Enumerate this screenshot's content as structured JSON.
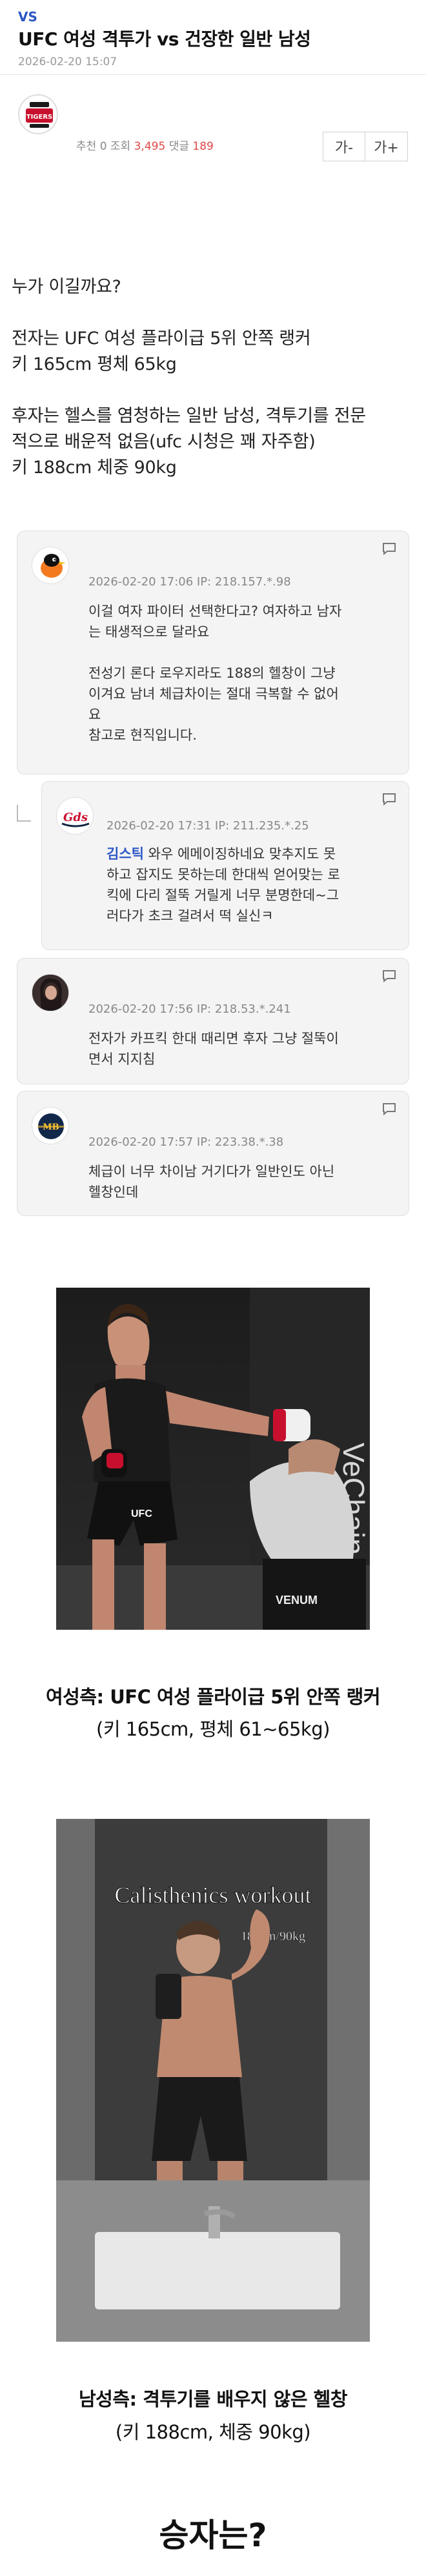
{
  "header": {
    "category": "VS",
    "title": "UFC 여성 격투가 vs 건장한 일반 남성",
    "date": "2026-02-20 15:07"
  },
  "stats": {
    "recommend_label": "추천",
    "recommend": "0",
    "views_label": "조회",
    "views": "3,495",
    "comments_label": "댓글",
    "comments": "189"
  },
  "font_controls": {
    "smaller": "가-",
    "larger": "가+"
  },
  "team_logo_text": "TIGERS",
  "post": {
    "lines": [
      "누가 이길까요?",
      "",
      "전자는 UFC 여성 플라이급 5위 안쪽 랭커",
      "키 165cm 평체 65kg",
      "",
      "후자는 헬스를 염청하는 일반 남성, 격투기를 전문",
      "적으로 배운적 없음(ufc 시청은 꽤 자주함)",
      "키 188cm 체중 90kg"
    ]
  },
  "comments": [
    {
      "meta": "2026-02-20 17:06  IP: 218.157.*.98",
      "lines": [
        "이걸 여자 파이터 선택한다고? 여자하고 남자",
        "는 태생적으로 달라요",
        "",
        "전성기 론다 로우지라도 188의 헬창이 그냥",
        "이겨요 남녀 체급차이는 절대 극복할 수 없어",
        "요",
        "참고로 현직입니다."
      ]
    },
    {
      "meta": "2026-02-20 17:31  IP: 211.235.*.25",
      "mention": "김스틱",
      "lines": [
        " 와우 에메이징하네요 맞추지도 못",
        "하고 잡지도 못하는데 한대씩 얻어맞는 로",
        "킥에 다리 절뚝 거릴게 너무 분명한데~그",
        "러다가 초크 걸려서 떡 실신ㅋ"
      ]
    },
    {
      "meta": "2026-02-20 17:56  IP: 218.53.*.241",
      "lines": [
        "전자가 카프킥 한대 때리면 후자 그냥 절뚝이",
        "면서 지지침"
      ]
    },
    {
      "meta": "2026-02-20 17:57  IP: 223.38.*.38",
      "lines": [
        "체급이 너무 차이남 거기다가 일반인도 아닌",
        "헬창인데"
      ]
    }
  ],
  "photo1": {
    "overlay_text": "VeChain",
    "shorts_text": "UFC",
    "venum_text": "VENUM",
    "caption_bold": "여성측: UFC 여성 플라이급 5위 안쪽 랭커",
    "caption_normal": "(키 165cm, 평체 61~65kg)"
  },
  "photo2": {
    "overlay_title": "Calisthenics workout",
    "overlay_small": "188cm/90kg",
    "caption_bold": "남성측: 격투기를 배우지 않은 헬창",
    "caption_normal": "(키 188cm, 체중 90kg)"
  },
  "winner_text": "승자는?",
  "colors": {
    "accent_blue": "#2c57c5",
    "stat_red": "#e04848"
  }
}
